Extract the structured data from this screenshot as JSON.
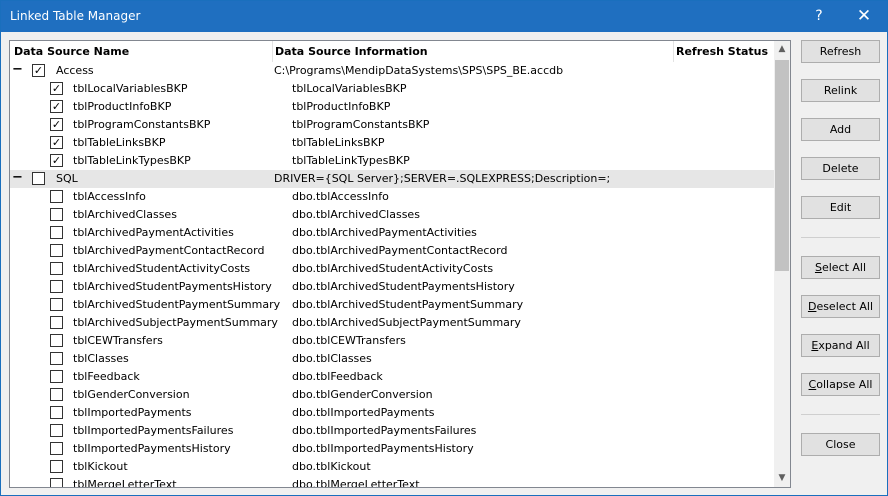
{
  "window": {
    "title": "Linked Table Manager",
    "help_label": "?",
    "close_label": "✕"
  },
  "columns": {
    "name": "Data Source Name",
    "info": "Data Source Information",
    "status": "Refresh Status"
  },
  "groups": [
    {
      "toggle": "−",
      "checked": true,
      "name": "Access",
      "info": "C:\\Programs\\MendipDataSystems\\SPS\\SPS_BE.accdb",
      "items": [
        {
          "checked": true,
          "name": "tblLocalVariablesBKP",
          "info": "tblLocalVariablesBKP"
        },
        {
          "checked": true,
          "name": "tblProductInfoBKP",
          "info": "tblProductInfoBKP"
        },
        {
          "checked": true,
          "name": "tblProgramConstantsBKP",
          "info": "tblProgramConstantsBKP"
        },
        {
          "checked": true,
          "name": "tblTableLinksBKP",
          "info": "tblTableLinksBKP"
        },
        {
          "checked": true,
          "name": "tblTableLinkTypesBKP",
          "info": "tblTableLinkTypesBKP"
        }
      ]
    },
    {
      "toggle": "−",
      "checked": false,
      "name": "SQL",
      "info": "DRIVER={SQL Server};SERVER=.SQLEXPRESS;Description=;",
      "items": [
        {
          "checked": false,
          "name": "tblAccessInfo",
          "info": "dbo.tblAccessInfo"
        },
        {
          "checked": false,
          "name": "tblArchivedClasses",
          "info": "dbo.tblArchivedClasses"
        },
        {
          "checked": false,
          "name": "tblArchivedPaymentActivities",
          "info": "dbo.tblArchivedPaymentActivities"
        },
        {
          "checked": false,
          "name": "tblArchivedPaymentContactRecord",
          "info": "dbo.tblArchivedPaymentContactRecord"
        },
        {
          "checked": false,
          "name": "tblArchivedStudentActivityCosts",
          "info": "dbo.tblArchivedStudentActivityCosts"
        },
        {
          "checked": false,
          "name": "tblArchivedStudentPaymentsHistory",
          "info": "dbo.tblArchivedStudentPaymentsHistory"
        },
        {
          "checked": false,
          "name": "tblArchivedStudentPaymentSummary",
          "info": "dbo.tblArchivedStudentPaymentSummary"
        },
        {
          "checked": false,
          "name": "tblArchivedSubjectPaymentSummary",
          "info": "dbo.tblArchivedSubjectPaymentSummary"
        },
        {
          "checked": false,
          "name": "tblCEWTransfers",
          "info": "dbo.tblCEWTransfers"
        },
        {
          "checked": false,
          "name": "tblClasses",
          "info": "dbo.tblClasses"
        },
        {
          "checked": false,
          "name": "tblFeedback",
          "info": "dbo.tblFeedback"
        },
        {
          "checked": false,
          "name": "tblGenderConversion",
          "info": "dbo.tblGenderConversion"
        },
        {
          "checked": false,
          "name": "tblImportedPayments",
          "info": "dbo.tblImportedPayments"
        },
        {
          "checked": false,
          "name": "tblImportedPaymentsFailures",
          "info": "dbo.tblImportedPaymentsFailures"
        },
        {
          "checked": false,
          "name": "tblImportedPaymentsHistory",
          "info": "dbo.tblImportedPaymentsHistory"
        },
        {
          "checked": false,
          "name": "tblKickout",
          "info": "dbo.tblKickout"
        },
        {
          "checked": false,
          "name": "tblMergeLetterText",
          "info": "dbo.tblMergeLetterText"
        }
      ]
    }
  ],
  "checkmark": "✓",
  "buttons": {
    "refresh": "Refresh",
    "relink": "Relink",
    "add": "Add",
    "delete": "Delete",
    "edit": "Edit",
    "select_all": {
      "mnemonic": "S",
      "rest": "elect All"
    },
    "deselect_all": {
      "mnemonic": "D",
      "rest": "eselect All"
    },
    "expand_all": {
      "mnemonic": "E",
      "rest": "xpand All"
    },
    "collapse_all": {
      "mnemonic": "C",
      "rest": "ollapse All"
    },
    "close": "Close"
  },
  "scroll": {
    "up_icon": "▲",
    "down_icon": "▼"
  }
}
